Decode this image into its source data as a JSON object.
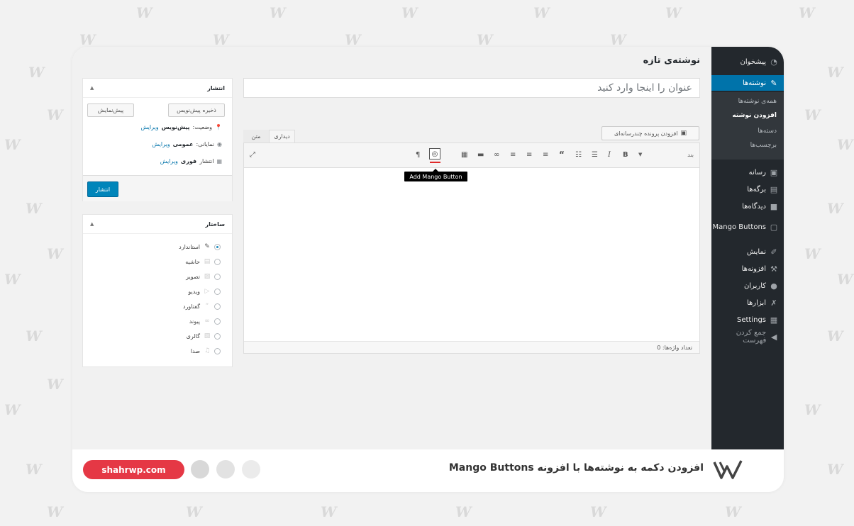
{
  "watermark": "W",
  "colors": {
    "admin_menu_bg": "#23282d",
    "active_menu": "#0073aa",
    "link": "#0073aa",
    "publish_button": "#0085ba",
    "brand_pill": "#e53845"
  },
  "admin_menu": {
    "items": [
      {
        "label": "پیشخوان",
        "icon": "dashboard-icon"
      },
      {
        "label": "نوشته‌ها",
        "icon": "pin-icon",
        "active": true
      },
      {
        "label": "رسانه",
        "icon": "media-icon"
      },
      {
        "label": "برگه‌ها",
        "icon": "page-icon"
      },
      {
        "label": "دیدگاه‌ها",
        "icon": "comment-icon"
      },
      {
        "label": "Mango Buttons",
        "icon": "mango-buttons-icon"
      },
      {
        "label": "نمایش",
        "icon": "appearance-icon"
      },
      {
        "label": "افزونه‌ها",
        "icon": "plugins-icon"
      },
      {
        "label": "کاربران",
        "icon": "users-icon"
      },
      {
        "label": "ابزارها",
        "icon": "tools-icon"
      },
      {
        "label": "Settings",
        "icon": "settings-icon"
      },
      {
        "label": "جمع کردن فهرست",
        "icon": "collapse-icon"
      }
    ],
    "submenu": [
      "همه‌ی نوشته‌ها",
      "افزودن نوشته",
      "دسته‌ها",
      "برچسب‌ها"
    ],
    "current_submenu": "افزودن نوشته"
  },
  "page": {
    "title": "نوشته‌ی تازه",
    "title_placeholder": "عنوان را اینجا وارد کنید"
  },
  "editor": {
    "add_media": "افزودن پرونده چندرسانه‌ای",
    "tab_visual": "دیداری",
    "tab_text": "متن",
    "format_select": "بند",
    "tooltip": "Add Mango Button",
    "word_count": "تعداد واژه‌ها: 0",
    "toolbar_icons": [
      "fullscreen-icon",
      "paragraph-icon",
      "mango-button-icon",
      "keyboard-icon",
      "more-icon",
      "link-icon",
      "align-right-icon",
      "align-center-icon",
      "align-left-icon",
      "blockquote-icon",
      "numbered-list-icon",
      "bullet-list-icon",
      "italic-icon",
      "bold-icon"
    ]
  },
  "publish_box": {
    "title": "انتشار",
    "save_draft": "ذخیره پیش‌نویس",
    "preview": "پیش‌نمایش",
    "status_label": "وضعیت:",
    "status_value": "پیش‌نویس",
    "visibility_label": "نمایانی:",
    "visibility_value": "عمومی",
    "publish_label": "انتشار",
    "publish_value": "فوری",
    "edit": "ویرایش",
    "publish_button": "انتشار"
  },
  "format_box": {
    "title": "ساختار",
    "options": [
      "استاندارد",
      "حاشیه",
      "تصویر",
      "ویدیو",
      "گفتاورد",
      "پیوند",
      "گالری",
      "صدا"
    ],
    "selected": "استاندارد"
  },
  "footer": {
    "title": "افزودن دکمه به نوشته‌ها با افزونه Mango Buttons",
    "site": "shahrwp.com"
  }
}
